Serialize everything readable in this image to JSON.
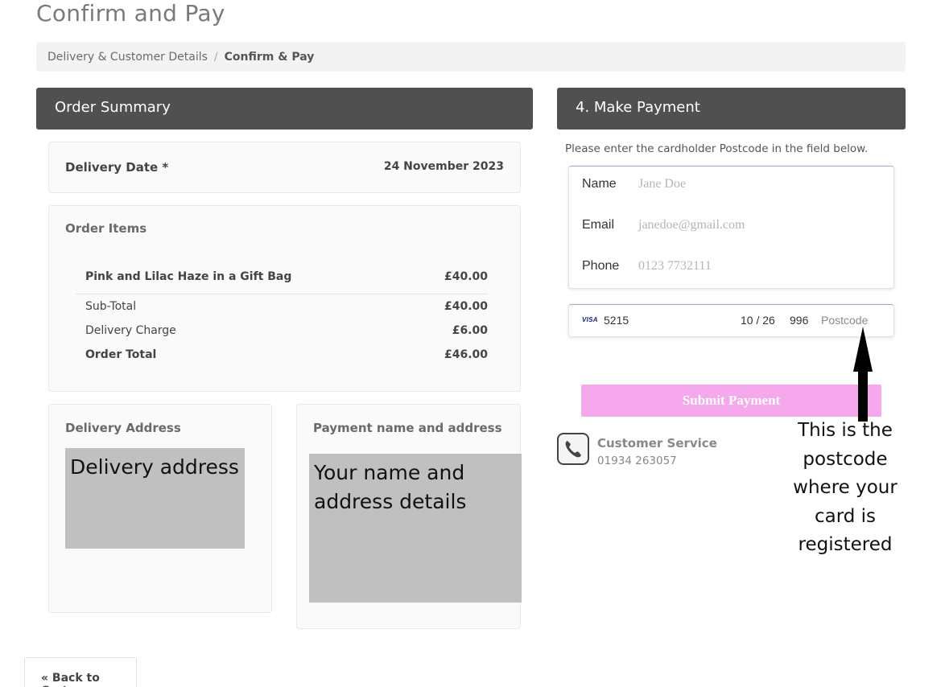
{
  "page": {
    "title": "Confirm and Pay"
  },
  "breadcrumb": {
    "step1": "Delivery & Customer Details",
    "separator": "/",
    "step2": "Confirm & Pay"
  },
  "order_summary": {
    "header": "Order Summary",
    "delivery_date_label": "Delivery Date *",
    "delivery_date_value": "24 November 2023",
    "items_label": "Order Items",
    "items": [
      {
        "name": "Pink and Lilac Haze in a Gift Bag",
        "price": "£40.00"
      }
    ],
    "subtotal_label": "Sub-Total",
    "subtotal_value": "£40.00",
    "delivery_label": "Delivery Charge",
    "delivery_value": "£6.00",
    "total_label": "Order Total",
    "total_value": "£46.00",
    "delivery_address_label": "Delivery Address",
    "delivery_address_placeholder": "Delivery address",
    "payment_address_label": "Payment name and address",
    "payment_address_placeholder": "Your name and address details"
  },
  "payment": {
    "header": "4. Make Payment",
    "instructions": "Please enter the cardholder Postcode in the field below.",
    "fields": {
      "name_label": "Name",
      "name_placeholder": "Jane Doe",
      "email_label": "Email",
      "email_placeholder": "janedoe@gmail.com",
      "phone_label": "Phone",
      "phone_placeholder": "0123 7732111"
    },
    "card": {
      "brand": "VISA",
      "number": "5215",
      "expiry": "10 / 26",
      "cvc": "996",
      "postcode_placeholder": "Postcode"
    },
    "submit_label": "Submit Payment"
  },
  "customer_service": {
    "title": "Customer Service",
    "phone": "01934 263057"
  },
  "annotation": {
    "text": "This is the postcode where your card is registered"
  },
  "navigation": {
    "back_label": "« Back to Cart"
  },
  "colors": {
    "header_bg": "#505050",
    "submit_bg": "#f5a8ec",
    "redaction": "#c0c0c0"
  }
}
